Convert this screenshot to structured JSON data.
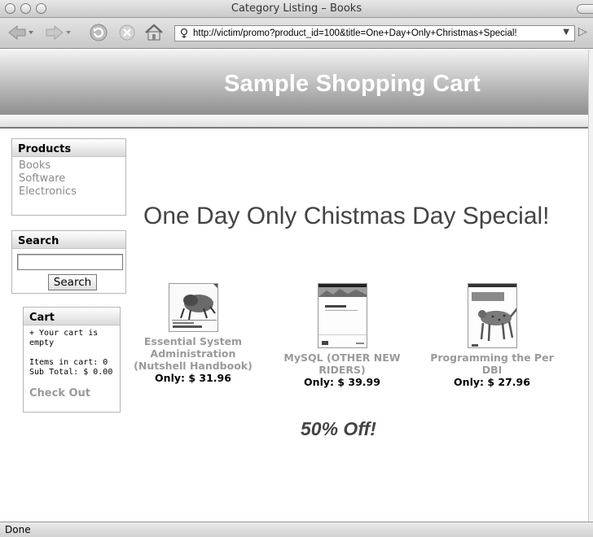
{
  "window": {
    "title": "Category Listing – Books"
  },
  "toolbar": {
    "url": "http://victim/promo?product_id=100&title=One+Day+Only+Christmas+Special!"
  },
  "banner": {
    "title": "Sample Shopping Cart"
  },
  "products_nav": {
    "heading": "Products",
    "items": [
      "Books",
      "Software",
      "Electronics"
    ]
  },
  "search": {
    "heading": "Search",
    "button": "Search",
    "value": ""
  },
  "cart": {
    "heading": "Cart",
    "empty_line1": "+ Your cart is",
    "empty_line2": "empty",
    "items_line": "Items in cart: 0",
    "subtotal_line": "Sub Total: $ 0.00",
    "checkout": "Check Out"
  },
  "promo": {
    "headline": "One Day Only Chistmas Day Special!",
    "discount": "50% Off!"
  },
  "products": [
    {
      "title_lines": [
        "Essential System",
        "Administration",
        "(Nutshell Handbook)"
      ],
      "price": "Only: $ 31.96"
    },
    {
      "title_lines": [
        "MySQL (OTHER NEW",
        "RIDERS)"
      ],
      "price": "Only: $ 39.99"
    },
    {
      "title_lines": [
        "Programming the Per",
        "DBI"
      ],
      "price": "Only: $ 27.96"
    }
  ],
  "status": {
    "text": "Done"
  }
}
